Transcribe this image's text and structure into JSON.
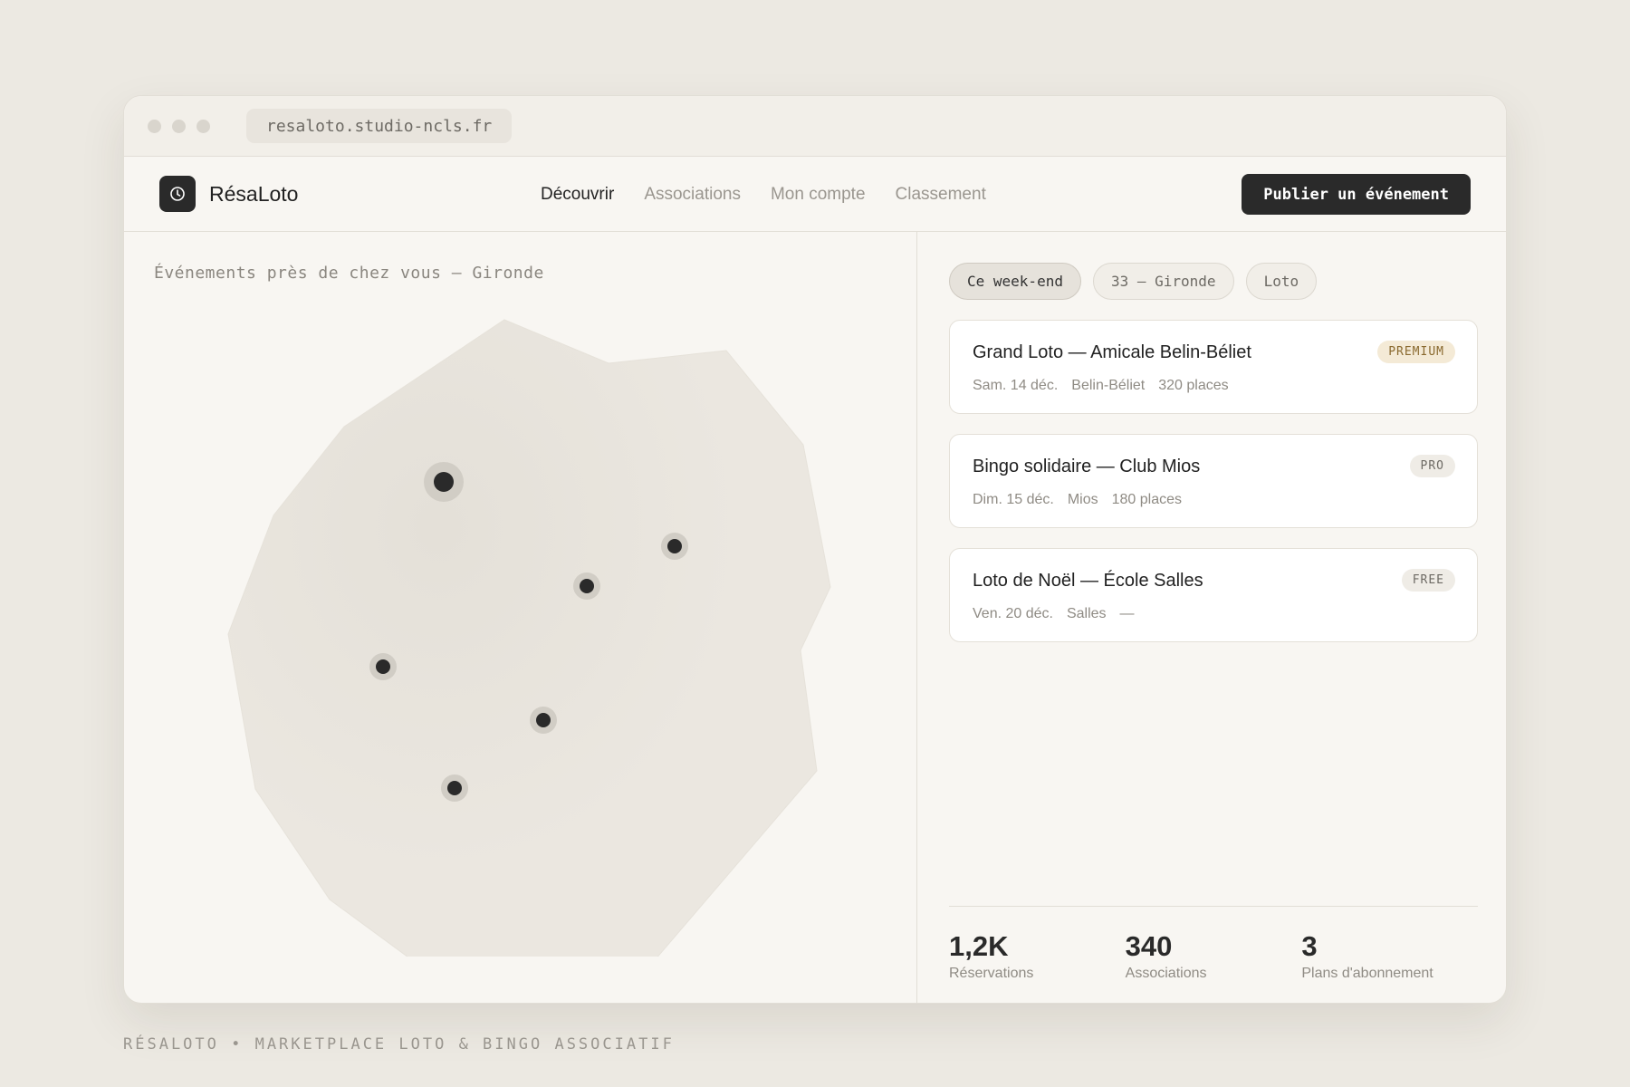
{
  "browser": {
    "url": "resaloto.studio-ncls.fr"
  },
  "brand": {
    "name": "RésaLoto",
    "logo_icon": "clock-icon"
  },
  "nav": {
    "items": [
      {
        "label": "Découvrir",
        "active": true
      },
      {
        "label": "Associations",
        "active": false
      },
      {
        "label": "Mon compte",
        "active": false
      },
      {
        "label": "Classement",
        "active": false
      }
    ],
    "cta_label": "Publier un événement"
  },
  "map_section": {
    "title": "Événements près de chez vous — Gironde",
    "markers": [
      {
        "emphasis": "large"
      },
      {
        "emphasis": "normal"
      },
      {
        "emphasis": "normal"
      },
      {
        "emphasis": "normal"
      },
      {
        "emphasis": "normal"
      },
      {
        "emphasis": "normal"
      }
    ]
  },
  "filters": [
    {
      "label": "Ce week-end",
      "active": true
    },
    {
      "label": "33 — Gironde",
      "active": false
    },
    {
      "label": "Loto",
      "active": false
    }
  ],
  "events": [
    {
      "title": "Grand Loto — Amicale Belin-Béliet",
      "date": "Sam. 14 déc.",
      "place": "Belin-Béliet",
      "capacity": "320 places",
      "badge": "PREMIUM",
      "badge_type": "premium"
    },
    {
      "title": "Bingo solidaire — Club Mios",
      "date": "Dim. 15 déc.",
      "place": "Mios",
      "capacity": "180 places",
      "badge": "PRO",
      "badge_type": "pro"
    },
    {
      "title": "Loto de Noël — École Salles",
      "date": "Ven. 20 déc.",
      "place": "Salles",
      "capacity": "—",
      "badge": "FREE",
      "badge_type": "free"
    }
  ],
  "stats": [
    {
      "value": "1,2K",
      "label": "Réservations"
    },
    {
      "value": "340",
      "label": "Associations"
    },
    {
      "value": "3",
      "label": "Plans d'abonnement"
    }
  ],
  "footer": "RÉSALOTO • MARKETPLACE LOTO & BINGO ASSOCIATIF",
  "colors": {
    "accent": "#2a2a2a",
    "background": "#ece9e2",
    "panel": "#f8f6f2",
    "map_fill": "#ebe7e0",
    "premium_badge": "#f4ead6"
  }
}
